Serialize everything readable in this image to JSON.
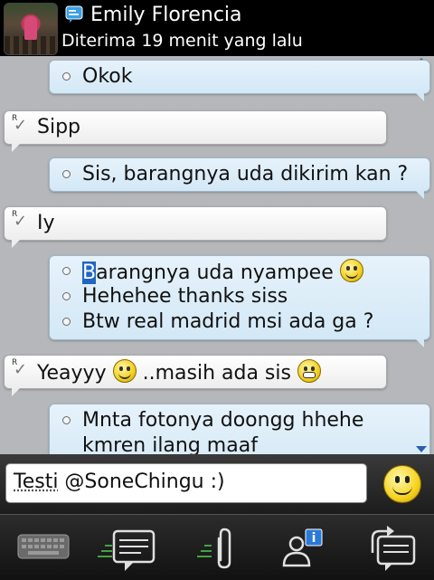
{
  "header": {
    "contact_name": "Emily Florencia",
    "status": "Diterima 19 menit yang lalu",
    "bbm_icon": "bbm-chat-icon"
  },
  "messages": [
    {
      "sender": "me",
      "lines": [
        "Okok"
      ]
    },
    {
      "sender": "them",
      "lines": [
        "Sipp"
      ],
      "receipt": "R"
    },
    {
      "sender": "me",
      "lines": [
        "Sis, barangnya uda dikirim kan ?"
      ]
    },
    {
      "sender": "them",
      "lines": [
        "Iy"
      ],
      "receipt": "R"
    },
    {
      "sender": "me",
      "lines": [
        "Barangnya uda nyampee",
        "Hehehee thanks siss",
        "Btw real madrid msi ada ga ?"
      ]
    },
    {
      "sender": "them",
      "lines": [
        "Yeayyy",
        "..masih ada sis"
      ],
      "receipt": "R"
    },
    {
      "sender": "me",
      "lines": [
        "Mnta fotonya doongg hhehe",
        "kmren ilang maaf"
      ]
    }
  ],
  "first_char_highlight": "B",
  "composer": {
    "word1": "Testi",
    "rest": " @SoneChingu :)"
  },
  "toolbar": {
    "items": [
      "keyboard-icon",
      "chat-icon",
      "attach-paperclip-icon",
      "contact-info-icon",
      "switch-chat-icon"
    ]
  },
  "colors": {
    "my_bubble": "#d3e8f6",
    "their_bubble": "#ededed",
    "highlight": "#2166c4",
    "scroll_arrow": "#2a5fb0"
  }
}
